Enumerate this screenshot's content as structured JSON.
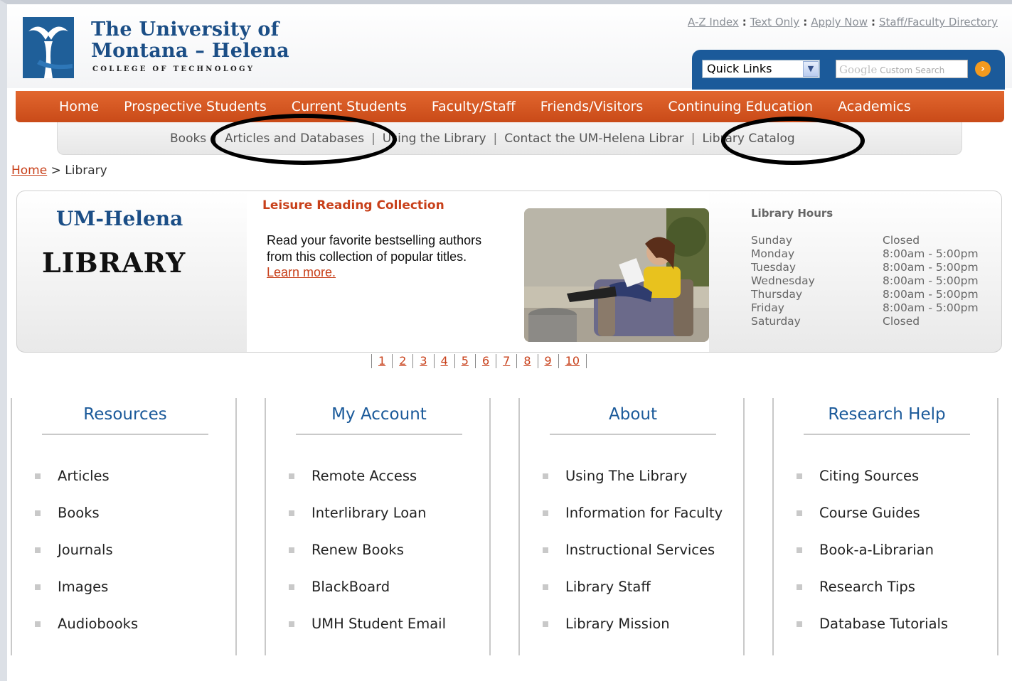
{
  "header": {
    "uni_line1": "The University of",
    "uni_line2": "Montana – Helena",
    "college": "COLLEGE OF TECHNOLOGY",
    "util_links": [
      "A-Z Index",
      "Text Only",
      "Apply Now",
      "Staff/Faculty Directory"
    ],
    "quick_links_value": "Quick Links",
    "search_brand": "Google",
    "search_placeholder": "Custom Search"
  },
  "nav": {
    "main": [
      "Home",
      "Prospective Students",
      "Current Students",
      "Faculty/Staff",
      "Friends/Visitors",
      "Continuing Education",
      "Academics"
    ],
    "sub": [
      "Books",
      "Articles and Databases",
      "Using the Library",
      "Contact the UM-Helena Librar",
      "Library Catalog"
    ]
  },
  "breadcrumb": {
    "home": "Home",
    "separator": ">",
    "current": "Library"
  },
  "banner": {
    "title_line1": "UM-Helena",
    "title_line2": "LIBRARY",
    "feature_title": "Leisure Reading Collection",
    "feature_text": "Read your favorite bestselling authors from this collection of popular titles.",
    "learn_more": "Learn more.",
    "hours_title": "Library Hours",
    "hours": [
      {
        "day": "Sunday",
        "time": "Closed"
      },
      {
        "day": "Monday",
        "time": "8:00am - 5:00pm"
      },
      {
        "day": "Tuesday",
        "time": "8:00am - 5:00pm"
      },
      {
        "day": "Wednesday",
        "time": "8:00am - 5:00pm"
      },
      {
        "day": "Thursday",
        "time": "8:00am - 5:00pm"
      },
      {
        "day": "Friday",
        "time": "8:00am - 5:00pm"
      },
      {
        "day": "Saturday",
        "time": "Closed"
      }
    ]
  },
  "pager": [
    "1",
    "2",
    "3",
    "4",
    "5",
    "6",
    "7",
    "8",
    "9",
    "10"
  ],
  "columns": [
    {
      "title": "Resources",
      "items": [
        "Articles",
        "Books",
        "Journals",
        "Images",
        "Audiobooks"
      ]
    },
    {
      "title": "My Account",
      "items": [
        "Remote Access",
        "Interlibrary Loan",
        "Renew Books",
        "BlackBoard",
        "UMH Student Email"
      ]
    },
    {
      "title": "About",
      "items": [
        "Using The Library",
        "Information for Faculty",
        "Instructional Services",
        "Library Staff",
        "Library Mission"
      ]
    },
    {
      "title": "Research Help",
      "items": [
        "Citing Sources",
        "Course Guides",
        "Book-a-Librarian",
        "Research Tips",
        "Database Tutorials"
      ]
    }
  ],
  "colors": {
    "brand_blue": "#1b4e86",
    "nav_orange": "#d95525",
    "link_red": "#c8401a"
  }
}
